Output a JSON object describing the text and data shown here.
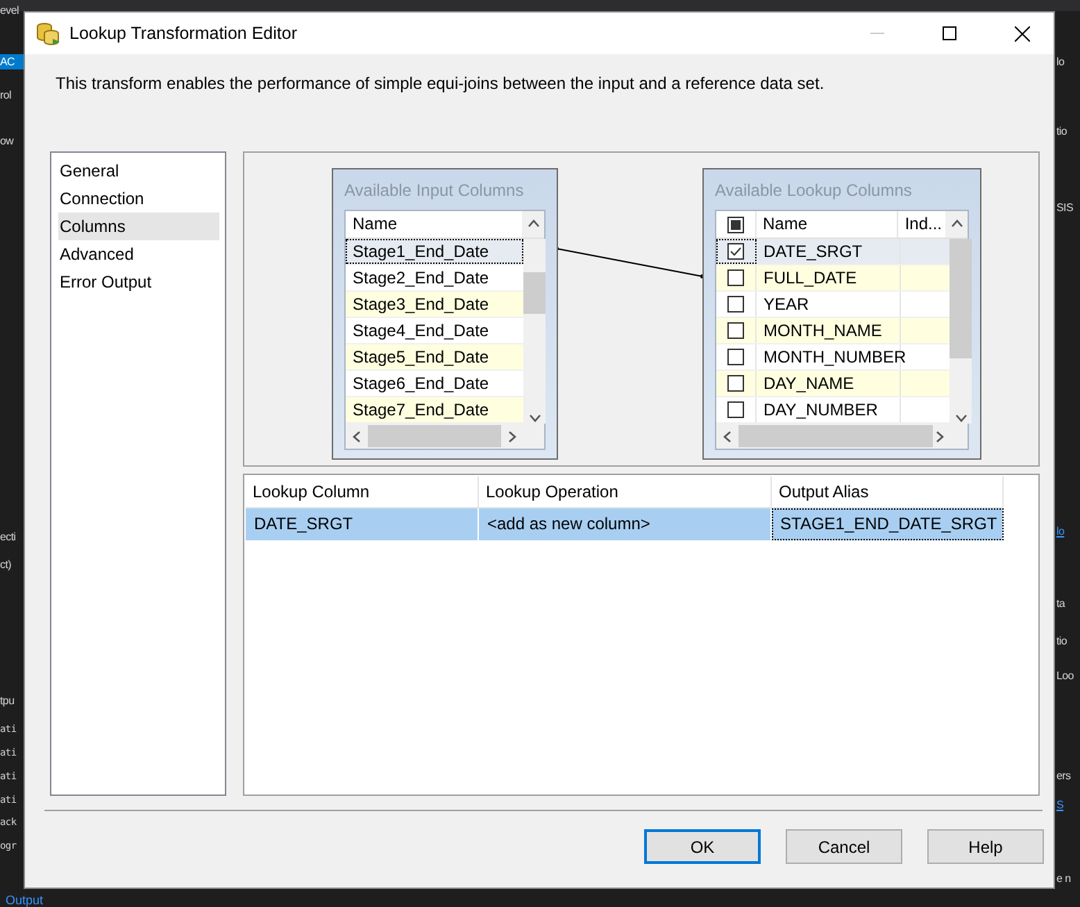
{
  "background": {
    "left_texts": [
      {
        "text": "evel",
        "kind": "text"
      },
      {
        "text": "AC",
        "kind": "highlight"
      },
      {
        "text": "rol",
        "kind": "text"
      },
      {
        "text": "ow",
        "kind": "text"
      },
      {
        "text": "ecti",
        "kind": "text"
      },
      {
        "text": "ct)",
        "kind": "text"
      },
      {
        "text": "tpu",
        "kind": "text"
      },
      {
        "text": "ati",
        "kind": "code"
      },
      {
        "text": "ati",
        "kind": "code"
      },
      {
        "text": "ati",
        "kind": "code"
      },
      {
        "text": "ati",
        "kind": "code"
      },
      {
        "text": "ack",
        "kind": "code"
      },
      {
        "text": "ogr",
        "kind": "code"
      }
    ],
    "right_texts": [
      {
        "text": "lo",
        "kind": "text"
      },
      {
        "text": "tio",
        "kind": "text"
      },
      {
        "text": "SIS",
        "kind": "text"
      },
      {
        "text": "lo",
        "kind": "link"
      },
      {
        "text": "ta",
        "kind": "text"
      },
      {
        "text": "tio",
        "kind": "text"
      },
      {
        "text": "Loo",
        "kind": "text"
      },
      {
        "text": "ers",
        "kind": "text"
      },
      {
        "text": "S",
        "kind": "link"
      },
      {
        "text": "e n",
        "kind": "text"
      }
    ],
    "bottom_tab": "Output"
  },
  "window": {
    "title": "Lookup Transformation Editor"
  },
  "description": "This transform enables the performance of simple equi-joins between the input and a reference data set.",
  "nav": [
    {
      "label": "General",
      "selected": false
    },
    {
      "label": "Connection",
      "selected": false
    },
    {
      "label": "Columns",
      "selected": true
    },
    {
      "label": "Advanced",
      "selected": false
    },
    {
      "label": "Error Output",
      "selected": false
    }
  ],
  "input_columns": {
    "title": "Available Input Columns",
    "header": "Name",
    "rows": [
      {
        "name": "Stage1_End_Date",
        "selected": true,
        "shaded": false
      },
      {
        "name": "Stage2_End_Date",
        "selected": false,
        "shaded": false
      },
      {
        "name": "Stage3_End_Date",
        "selected": false,
        "shaded": true
      },
      {
        "name": "Stage4_End_Date",
        "selected": false,
        "shaded": false
      },
      {
        "name": "Stage5_End_Date",
        "selected": false,
        "shaded": true
      },
      {
        "name": "Stage6_End_Date",
        "selected": false,
        "shaded": false
      },
      {
        "name": "Stage7_End_Date",
        "selected": false,
        "shaded": true
      }
    ]
  },
  "lookup_columns": {
    "title": "Available Lookup Columns",
    "headers": [
      "Name",
      "Ind..."
    ],
    "select_all_mixed": true,
    "rows": [
      {
        "name": "DATE_SRGT",
        "checked": true,
        "selected": true,
        "shaded": false
      },
      {
        "name": "FULL_DATE",
        "checked": false,
        "selected": false,
        "shaded": true
      },
      {
        "name": "YEAR",
        "checked": false,
        "selected": false,
        "shaded": false
      },
      {
        "name": "MONTH_NAME",
        "checked": false,
        "selected": false,
        "shaded": true
      },
      {
        "name": "MONTH_NUMBER",
        "checked": false,
        "selected": false,
        "shaded": false
      },
      {
        "name": "DAY_NAME",
        "checked": false,
        "selected": false,
        "shaded": true
      },
      {
        "name": "DAY_NUMBER",
        "checked": false,
        "selected": false,
        "shaded": false
      }
    ]
  },
  "mappings": {
    "columns": [
      "Lookup Column",
      "Lookup Operation",
      "Output Alias"
    ],
    "rows": [
      {
        "cells": [
          "DATE_SRGT",
          "<add as new column>",
          "STAGE1_END_DATE_SRGT"
        ],
        "selected": true
      }
    ]
  },
  "buttons": [
    {
      "label": "OK",
      "default": true
    },
    {
      "label": "Cancel",
      "default": false
    },
    {
      "label": "Help",
      "default": false
    }
  ]
}
